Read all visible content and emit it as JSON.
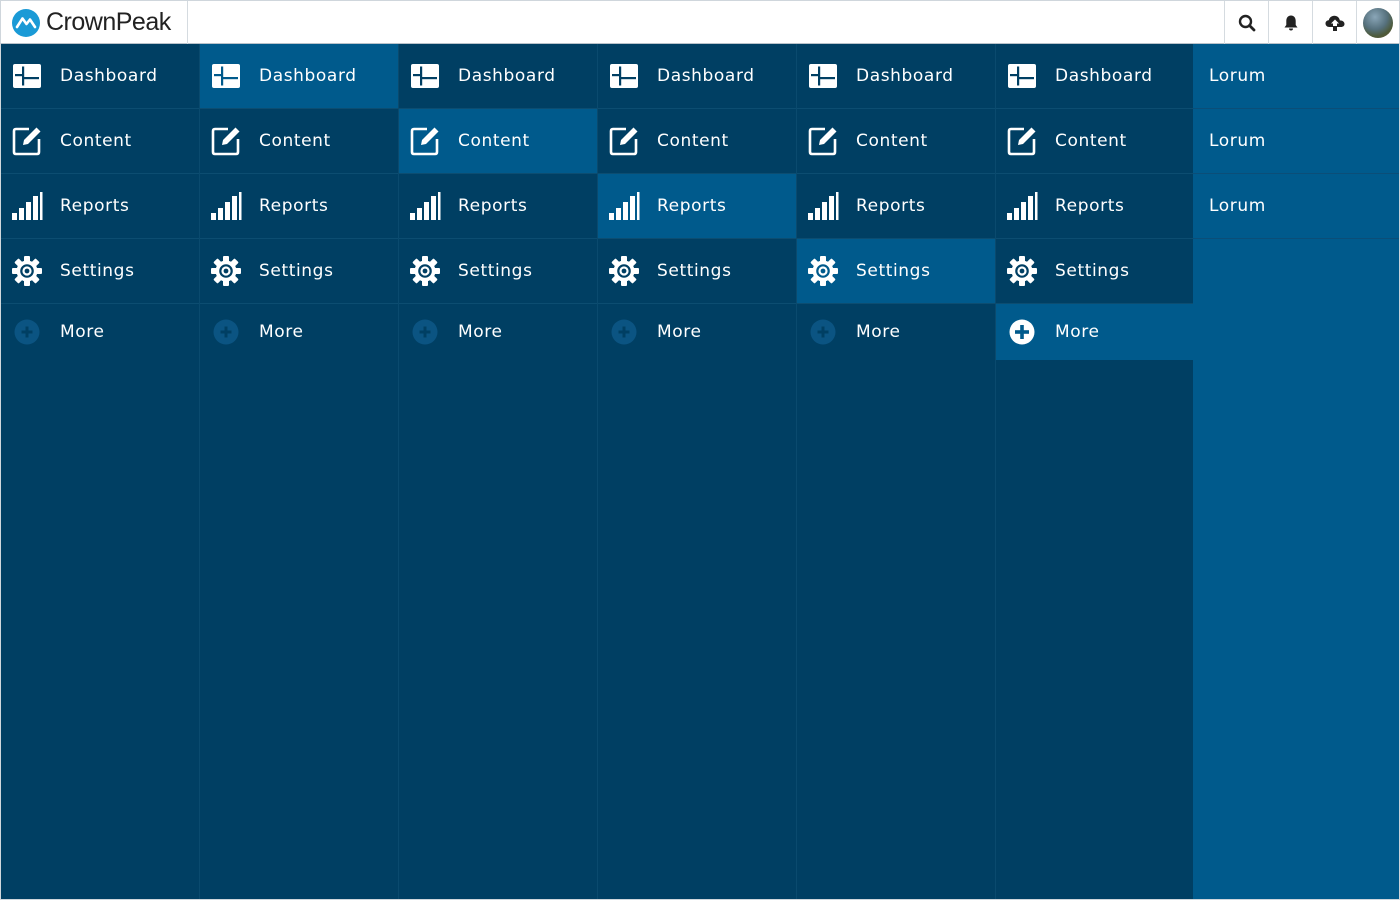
{
  "app": {
    "brand_name": "CrownPeak",
    "logo_icon": "crownpeak-mountain-logo",
    "accent_color": "#1a9ad6"
  },
  "topbar": {
    "actions": [
      {
        "icon": "search-icon"
      },
      {
        "icon": "bell-icon"
      },
      {
        "icon": "cloud-upload-icon"
      },
      {
        "icon": "avatar"
      }
    ]
  },
  "colors": {
    "nav_background": "#003f63",
    "nav_active": "#005a8c",
    "subpanel_background": "#005a8c"
  },
  "nav_columns": [
    {
      "active_index": -1,
      "items": [
        {
          "label": "Dashboard",
          "icon": "dashboard-icon"
        },
        {
          "label": "Content",
          "icon": "edit-icon"
        },
        {
          "label": "Reports",
          "icon": "bar-chart-icon"
        },
        {
          "label": "Settings",
          "icon": "gear-icon"
        },
        {
          "label": "More",
          "icon": "plus-circle-icon"
        }
      ]
    },
    {
      "active_index": 0,
      "items": [
        {
          "label": "Dashboard",
          "icon": "dashboard-icon"
        },
        {
          "label": "Content",
          "icon": "edit-icon"
        },
        {
          "label": "Reports",
          "icon": "bar-chart-icon"
        },
        {
          "label": "Settings",
          "icon": "gear-icon"
        },
        {
          "label": "More",
          "icon": "plus-circle-icon"
        }
      ]
    },
    {
      "active_index": 1,
      "items": [
        {
          "label": "Dashboard",
          "icon": "dashboard-icon"
        },
        {
          "label": "Content",
          "icon": "edit-icon"
        },
        {
          "label": "Reports",
          "icon": "bar-chart-icon"
        },
        {
          "label": "Settings",
          "icon": "gear-icon"
        },
        {
          "label": "More",
          "icon": "plus-circle-icon"
        }
      ]
    },
    {
      "active_index": 2,
      "items": [
        {
          "label": "Dashboard",
          "icon": "dashboard-icon"
        },
        {
          "label": "Content",
          "icon": "edit-icon"
        },
        {
          "label": "Reports",
          "icon": "bar-chart-icon"
        },
        {
          "label": "Settings",
          "icon": "gear-icon"
        },
        {
          "label": "More",
          "icon": "plus-circle-icon"
        }
      ]
    },
    {
      "active_index": 3,
      "items": [
        {
          "label": "Dashboard",
          "icon": "dashboard-icon"
        },
        {
          "label": "Content",
          "icon": "edit-icon"
        },
        {
          "label": "Reports",
          "icon": "bar-chart-icon"
        },
        {
          "label": "Settings",
          "icon": "gear-icon"
        },
        {
          "label": "More",
          "icon": "plus-circle-icon"
        }
      ]
    },
    {
      "active_index": 4,
      "items": [
        {
          "label": "Dashboard",
          "icon": "dashboard-icon"
        },
        {
          "label": "Content",
          "icon": "edit-icon"
        },
        {
          "label": "Reports",
          "icon": "bar-chart-icon"
        },
        {
          "label": "Settings",
          "icon": "gear-icon"
        },
        {
          "label": "More",
          "icon": "plus-circle-icon"
        }
      ]
    }
  ],
  "sub_panel": {
    "items": [
      {
        "label": "Lorum"
      },
      {
        "label": "Lorum"
      },
      {
        "label": "Lorum"
      }
    ]
  }
}
